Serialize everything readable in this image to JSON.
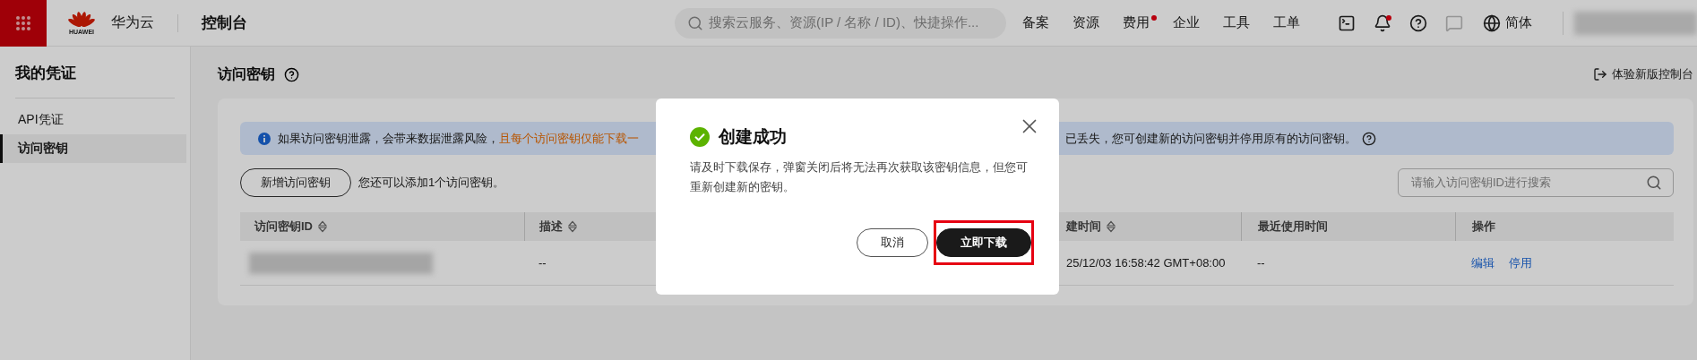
{
  "topbar": {
    "logo_text": "HUAWEI",
    "brand": "华为云",
    "console": "控制台",
    "search": {
      "placeholder": "搜索云服务、资源(IP / 名称 / ID)、快捷操作..."
    },
    "nav": [
      {
        "label": "备案",
        "dot": false
      },
      {
        "label": "资源",
        "dot": false
      },
      {
        "label": "费用",
        "dot": true
      },
      {
        "label": "企业",
        "dot": false
      },
      {
        "label": "工具",
        "dot": false
      },
      {
        "label": "工单",
        "dot": false
      }
    ],
    "icons": [
      {
        "kind": "terminal",
        "dot": false,
        "disabled": false
      },
      {
        "kind": "bell",
        "dot": true,
        "disabled": false
      },
      {
        "kind": "help",
        "dot": false,
        "disabled": false
      },
      {
        "kind": "message",
        "dot": false,
        "disabled": true
      }
    ],
    "language": "简体"
  },
  "sidebar": {
    "title": "我的凭证",
    "items": [
      {
        "label": "API凭证",
        "selected": false
      },
      {
        "label": "访问密钥",
        "selected": true
      }
    ]
  },
  "page": {
    "title": "访问密钥",
    "new_console_link": "体验新版控制台"
  },
  "notice": {
    "text_start": "如果访问密钥泄露，会带来数据泄露风险，",
    "highlight": "且每个访问密钥仅能下载一",
    "text_end": "已丢失，您可创建新的访问密钥并停用原有的访问密钥。"
  },
  "toolbar": {
    "create_button": "新增访问密钥",
    "quota_text": "您还可以添加1个访问密钥。",
    "search": {
      "placeholder": "请输入访问密钥ID进行搜索"
    }
  },
  "table": {
    "columns": [
      {
        "label": "访问密钥ID",
        "sortable": true
      },
      {
        "label": "描述",
        "sortable": true
      },
      {
        "label": "建时间",
        "sortable": true
      },
      {
        "label": "最近使用时间",
        "sortable": false
      },
      {
        "label": "操作",
        "sortable": false
      }
    ],
    "rows": [
      {
        "description": "--",
        "created": "25/12/03 16:58:42 GMT+08:00",
        "last_used": "--",
        "actions": [
          "编辑",
          "停用"
        ]
      }
    ]
  },
  "modal": {
    "title": "创建成功",
    "message": "请及时下载保存，弹窗关闭后将无法再次获取该密钥信息，但您可重新创建新的密钥。",
    "buttons": [
      {
        "label": "取消",
        "kind": "secondary",
        "highlighted": false
      },
      {
        "label": "立即下载",
        "kind": "primary",
        "highlighted": true
      }
    ]
  }
}
